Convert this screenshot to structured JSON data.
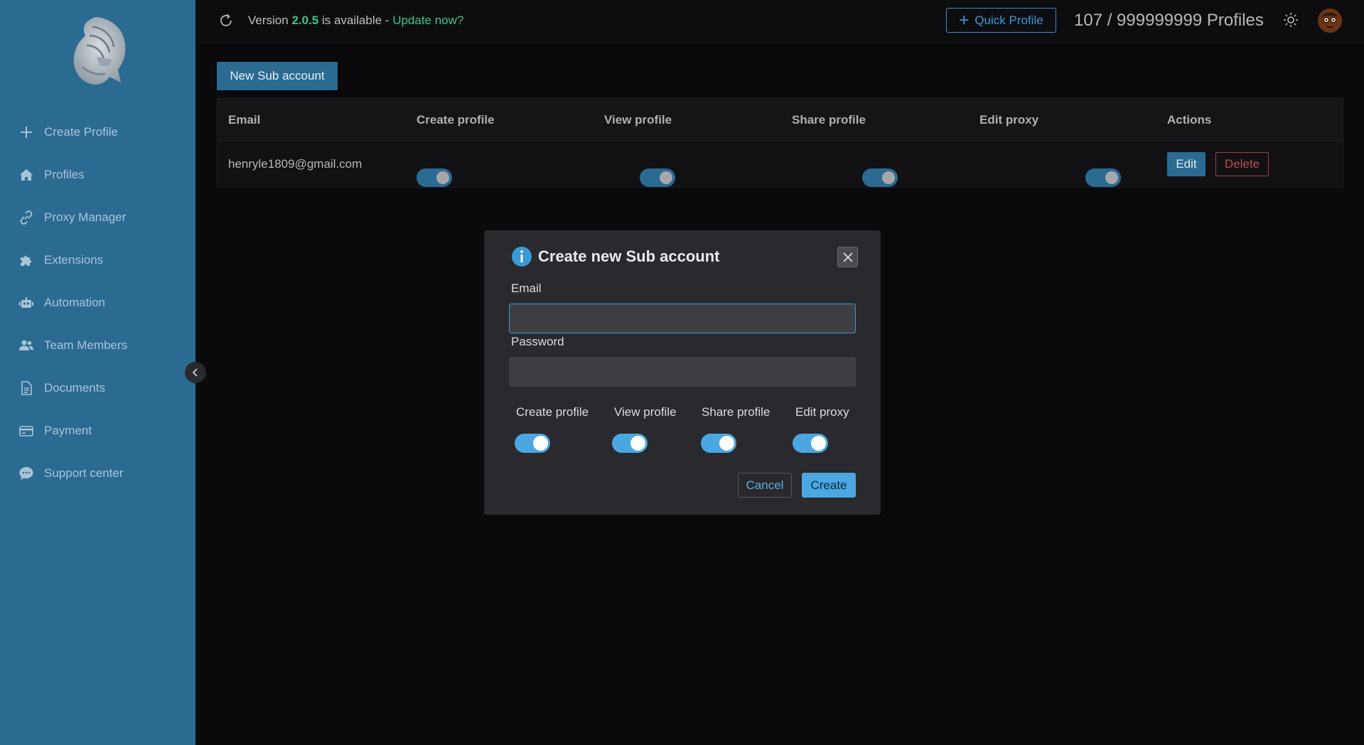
{
  "sidebar": {
    "items": [
      {
        "label": "Create Profile",
        "icon": "plus-icon"
      },
      {
        "label": "Profiles",
        "icon": "home-icon"
      },
      {
        "label": "Proxy Manager",
        "icon": "link-icon"
      },
      {
        "label": "Extensions",
        "icon": "puzzle-icon"
      },
      {
        "label": "Automation",
        "icon": "robot-icon"
      },
      {
        "label": "Team Members",
        "icon": "users-icon"
      },
      {
        "label": "Documents",
        "icon": "document-icon"
      },
      {
        "label": "Payment",
        "icon": "credit-card-icon"
      },
      {
        "label": "Support center",
        "icon": "chat-icon"
      }
    ]
  },
  "topbar": {
    "version_prefix": "Version ",
    "version_number": "2.0.5",
    "version_suffix": " is available - ",
    "update_link": "Update now?",
    "quick_profile": "Quick Profile",
    "profiles_count": "107 / 999999999 Profiles"
  },
  "content": {
    "new_sub_account": "New Sub account",
    "table": {
      "headers": [
        "Email",
        "Create profile",
        "View profile",
        "Share profile",
        "Edit proxy",
        "Actions"
      ],
      "rows": [
        {
          "email": "henryle1809@gmail.com",
          "create_profile": true,
          "view_profile": true,
          "share_profile": true,
          "edit_proxy": true,
          "edit_label": "Edit",
          "delete_label": "Delete"
        }
      ]
    }
  },
  "modal": {
    "title": "Create new Sub account",
    "email_label": "Email",
    "email_value": "",
    "password_label": "Password",
    "password_value": "",
    "permissions": [
      {
        "label": "Create profile",
        "enabled": true
      },
      {
        "label": "View profile",
        "enabled": true
      },
      {
        "label": "Share profile",
        "enabled": true
      },
      {
        "label": "Edit proxy",
        "enabled": true
      }
    ],
    "cancel_label": "Cancel",
    "create_label": "Create"
  },
  "colors": {
    "sidebar_bg": "#2b6b91",
    "accent": "#4ba7e0",
    "update_green": "#3ec48d",
    "delete_red": "#c14a50"
  }
}
